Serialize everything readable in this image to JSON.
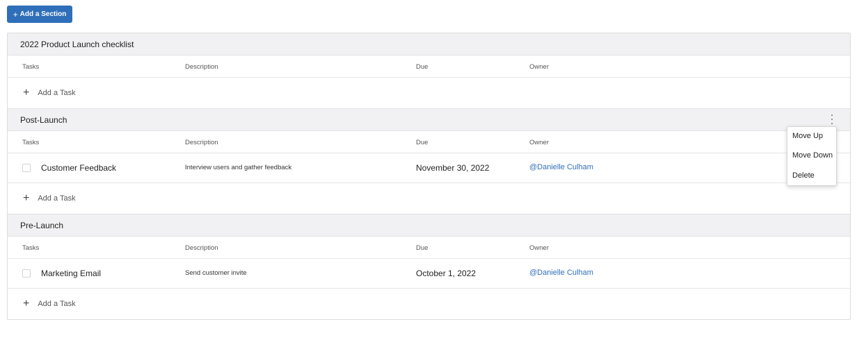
{
  "toolbar": {
    "add_section_label": "Add a Section"
  },
  "columns": {
    "tasks": "Tasks",
    "description": "Description",
    "due": "Due",
    "owner": "Owner"
  },
  "add_task_label": "Add a Task",
  "sections": [
    {
      "title": "2022 Product Launch checklist",
      "tasks": []
    },
    {
      "title": "Post-Launch",
      "tasks": [
        {
          "name": "Customer Feedback",
          "description": "Interview users and gather feedback",
          "due": "November 30, 2022",
          "owner": "@Danielle Culham",
          "checked": false
        }
      ]
    },
    {
      "title": "Pre-Launch",
      "tasks": [
        {
          "name": "Marketing Email",
          "description": "Send customer invite",
          "due": "October 1, 2022",
          "owner": "@Danielle Culham",
          "checked": false
        }
      ]
    }
  ],
  "section_menu": {
    "items": [
      "Move Up",
      "Move Down",
      "Delete"
    ]
  },
  "colors": {
    "accent": "#2f6fb9",
    "header_bg": "#f1f1f3",
    "border": "#dcdcdc"
  }
}
